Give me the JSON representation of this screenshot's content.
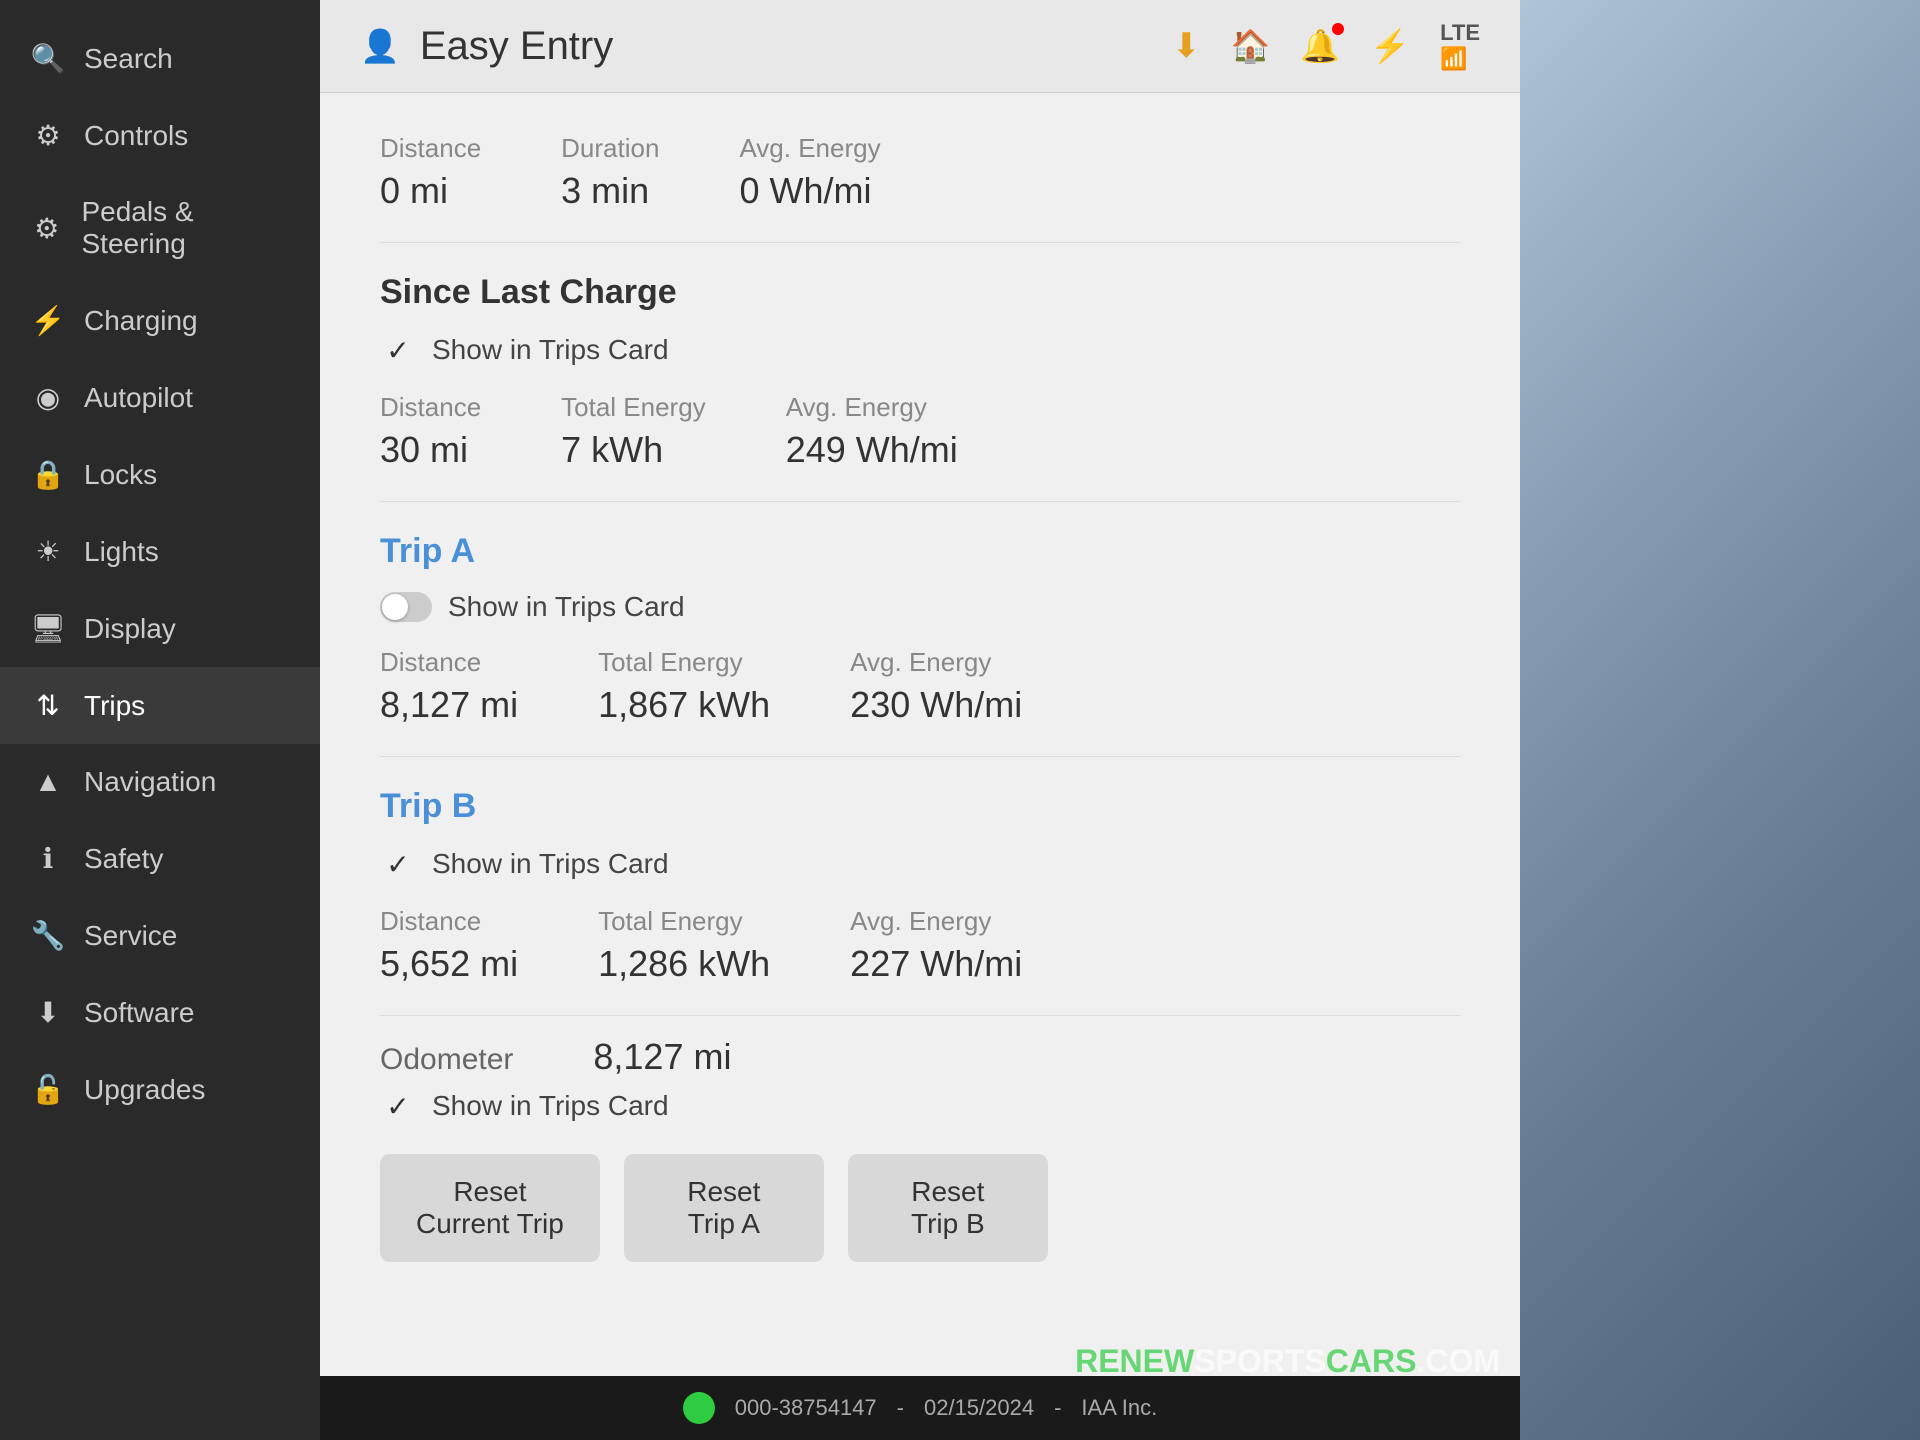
{
  "sidebar": {
    "items": [
      {
        "id": "search",
        "label": "Search",
        "icon": "🔍"
      },
      {
        "id": "controls",
        "label": "Controls",
        "icon": "⚙"
      },
      {
        "id": "pedals-steering",
        "label": "Pedals & Steering",
        "icon": "🚗"
      },
      {
        "id": "charging",
        "label": "Charging",
        "icon": "⚡"
      },
      {
        "id": "autopilot",
        "label": "Autopilot",
        "icon": "🅐"
      },
      {
        "id": "locks",
        "label": "Locks",
        "icon": "🔒"
      },
      {
        "id": "lights",
        "label": "Lights",
        "icon": "☀"
      },
      {
        "id": "display",
        "label": "Display",
        "icon": "🖥"
      },
      {
        "id": "trips",
        "label": "Trips",
        "icon": "↕",
        "active": true
      },
      {
        "id": "navigation",
        "label": "Navigation",
        "icon": "▲"
      },
      {
        "id": "safety",
        "label": "Safety",
        "icon": "ℹ"
      },
      {
        "id": "service",
        "label": "Service",
        "icon": "🔧"
      },
      {
        "id": "software",
        "label": "Software",
        "icon": "⬇"
      },
      {
        "id": "upgrades",
        "label": "Upgrades",
        "icon": "🔓"
      }
    ]
  },
  "header": {
    "profile_icon": "👤",
    "title": "Easy Entry",
    "download_icon": "⬇",
    "home_icon": "🏠",
    "bell_icon": "🔔",
    "bluetooth_icon": "⚡",
    "lte": "LTE",
    "signal": "📶"
  },
  "current_trip": {
    "distance_label": "Distance",
    "distance_value": "0 mi",
    "duration_label": "Duration",
    "duration_value": "3 min",
    "avg_energy_label": "Avg. Energy",
    "avg_energy_value": "0 Wh/mi"
  },
  "since_last_charge": {
    "title": "Since Last Charge",
    "show_in_trips_label": "Show in Trips Card",
    "checked": true,
    "distance_label": "Distance",
    "distance_value": "30 mi",
    "total_energy_label": "Total Energy",
    "total_energy_value": "7 kWh",
    "avg_energy_label": "Avg. Energy",
    "avg_energy_value": "249 Wh/mi"
  },
  "trip_a": {
    "title": "Trip A",
    "show_in_trips_label": "Show in Trips Card",
    "toggle_on": false,
    "distance_label": "Distance",
    "distance_value": "8,127 mi",
    "total_energy_label": "Total Energy",
    "total_energy_value": "1,867 kWh",
    "avg_energy_label": "Avg. Energy",
    "avg_energy_value": "230 Wh/mi"
  },
  "trip_b": {
    "title": "Trip B",
    "show_in_trips_label": "Show in Trips Card",
    "checked": true,
    "distance_label": "Distance",
    "distance_value": "5,652 mi",
    "total_energy_label": "Total Energy",
    "total_energy_value": "1,286 kWh",
    "avg_energy_label": "Avg. Energy",
    "avg_energy_value": "227 Wh/mi"
  },
  "odometer": {
    "label": "Odometer",
    "value": "8,127 mi",
    "show_in_trips_label": "Show in Trips Card",
    "checked": true
  },
  "buttons": {
    "reset_current": "Reset\nCurrent Trip",
    "reset_a": "Reset\nTrip A",
    "reset_b": "Reset\nTrip B"
  },
  "bottom_bar": {
    "phone": "000-38754147",
    "date": "02/15/2024",
    "company": "IAA Inc."
  },
  "watermark": {
    "renew": "RENEW",
    "sports": "SPORTS",
    "cars": "CARS",
    "com": ".COM"
  }
}
